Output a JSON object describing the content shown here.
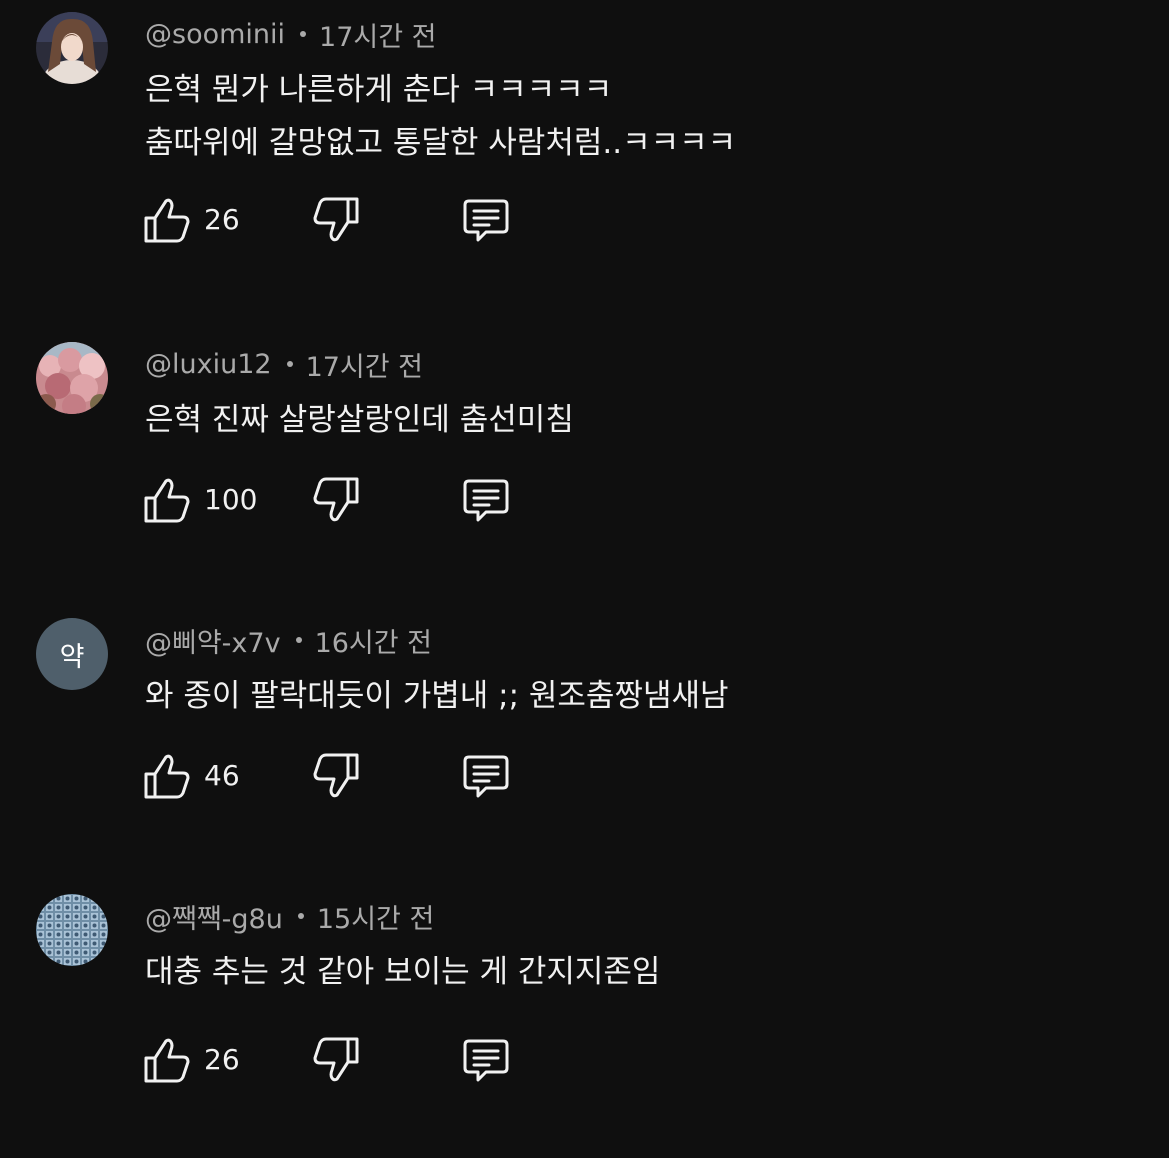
{
  "comments": [
    {
      "username": "@soominii",
      "time": "17시간 전",
      "text": "은혁 뭔가 나른하게 춘다 ㅋㅋㅋㅋㅋ\n춤따위에 갈망없고 통달한 사람처럼..ㅋㅋㅋㅋ",
      "likes": "26",
      "avatar_type": "photo-portrait"
    },
    {
      "username": "@luxiu12",
      "time": "17시간 전",
      "text": "은혁 진짜 살랑살랑인데 춤선미침",
      "likes": "100",
      "avatar_type": "photo-blossoms"
    },
    {
      "username": "@삐약-x7v",
      "time": "16시간 전",
      "text": "와 종이 팔락대듯이 가볍내 ;; 원조춤짱냄새남",
      "likes": "46",
      "avatar_type": "letter",
      "avatar_letter": "약"
    },
    {
      "username": "@짹짹-g8u",
      "time": "15시간 전",
      "text": "대충 추는 것 같아 보이는 게 간지지존임",
      "likes": "26",
      "avatar_type": "photo-pattern"
    }
  ],
  "icons": {
    "like": "thumbs-up-icon",
    "dislike": "thumbs-down-icon",
    "reply": "reply-icon"
  },
  "colors": {
    "background": "#0f0f0f",
    "text": "#f1f1f1",
    "meta": "#aaaaaa",
    "letter_avatar": "#4f5f6b"
  }
}
